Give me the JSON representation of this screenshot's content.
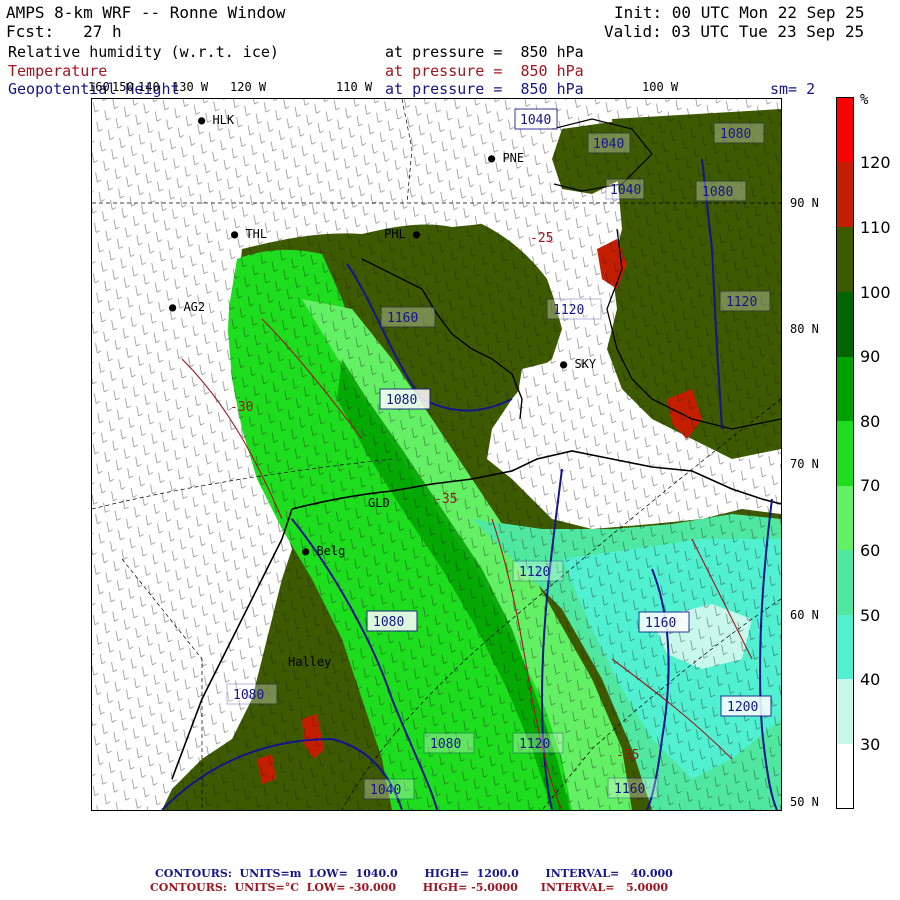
{
  "header": {
    "model": "AMPS 8-km WRF -- Ronne Window",
    "init": "Init: 00 UTC Mon 22 Sep 25",
    "fcst": "Fcst:   27 h",
    "valid": "Valid: 03 UTC Tue 23 Sep 25",
    "fields": [
      {
        "name": "Relative humidity (w.r.t. ice)",
        "level": "at pressure =  850 hPa",
        "color": "#000000"
      },
      {
        "name": "Temperature",
        "level": "at pressure =  850 hPa",
        "color": "#a0141e"
      },
      {
        "name": "Geopotential Height",
        "level": "at pressure =  850 hPa",
        "color": "#14148c"
      }
    ],
    "smoothing": "sm= 2"
  },
  "longitude_labels": [
    "160",
    "150",
    "140",
    "130 W",
    "120 W",
    "110 W",
    "100 W"
  ],
  "latitude_labels": [
    "90 N",
    "80 N",
    "70 N",
    "60 N",
    "50 N"
  ],
  "stations": [
    {
      "id": "HLK"
    },
    {
      "id": "PNE"
    },
    {
      "id": "THL"
    },
    {
      "id": "PHL"
    },
    {
      "id": "AG2"
    },
    {
      "id": "SKY"
    },
    {
      "id": "GLD"
    },
    {
      "id": "Belg"
    },
    {
      "id": "Halley"
    }
  ],
  "height_contour_labels": [
    "1040",
    "1040",
    "1080",
    "1080",
    "1120",
    "1040",
    "1160",
    "1080",
    "1120",
    "1120",
    "1080",
    "1160",
    "1080",
    "1080",
    "1120",
    "1200",
    "1160",
    "1040"
  ],
  "temperature_labels": [
    "-30",
    "-25",
    "-35",
    "-35"
  ],
  "colorbar": {
    "unit": "%",
    "ticks": [
      "120",
      "110",
      "100",
      "90",
      "80",
      "70",
      "60",
      "50",
      "40",
      "30"
    ],
    "colors": [
      "#ff0000",
      "#c41e00",
      "#3d5a00",
      "#006400",
      "#00a000",
      "#1edc1e",
      "#64f064",
      "#50e8a0",
      "#50f0d0",
      "#c8f8ec",
      "#ffffff"
    ]
  },
  "footer": {
    "height": "CONTOURS:  UNITS=m  LOW=  1040.0       HIGH=  1200.0       INTERVAL=   40.000",
    "temperature": "CONTOURS:  UNITS=°C  LOW= -30.000       HIGH= -5.0000      INTERVAL=   5.0000",
    "height_color": "#14148c",
    "temperature_color": "#a0141e"
  }
}
